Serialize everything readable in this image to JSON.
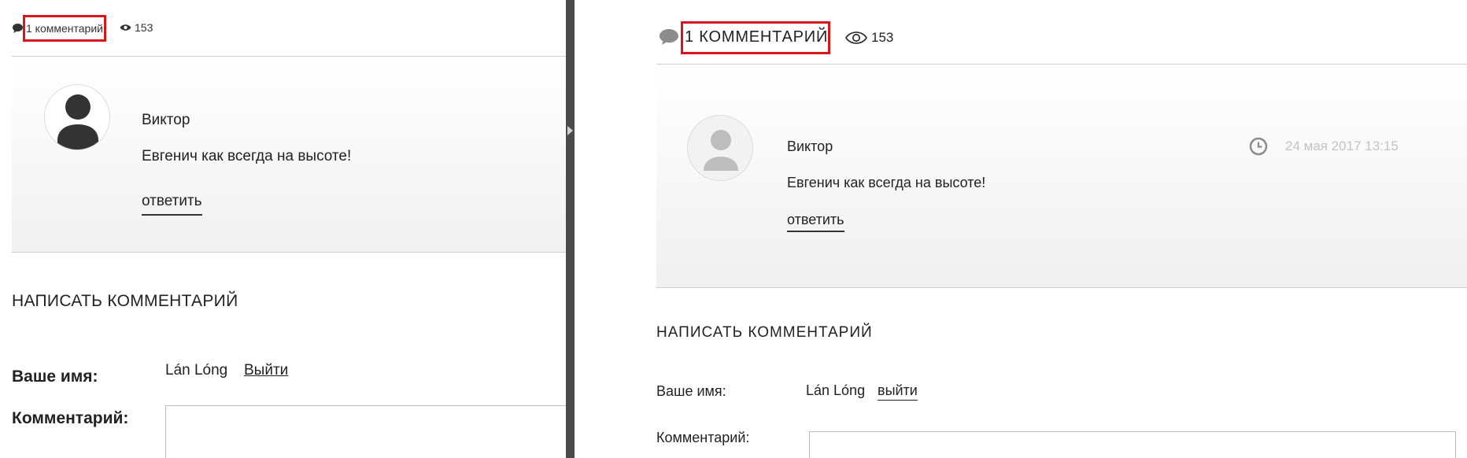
{
  "left": {
    "comments_count": "1 комментарий",
    "views_count": "153",
    "comment": {
      "author": "Виктор",
      "text": "Евгенич как всегда на высоте!",
      "reply_label": "ответить"
    },
    "form": {
      "heading": "НАПИСАТЬ КОММЕНТАРИЙ",
      "name_label": "Ваше имя:",
      "name_value": "Lán Lóng",
      "logout_label": "Выйти",
      "comment_label": "Комментарий:"
    }
  },
  "right": {
    "comments_count": "1 КОММЕНТАРИЙ",
    "views_count": "153",
    "comment": {
      "author": "Виктор",
      "date": "24 мая 2017  13:15",
      "text": "Евгенич как всегда на высоте!",
      "reply_label": "ответить"
    },
    "form": {
      "heading": "НАПИСАТЬ КОММЕНТАРИЙ",
      "name_label": "Ваше имя:",
      "name_value": "Lán Lóng",
      "logout_label": "выйти",
      "comment_label": "Комментарий:"
    }
  },
  "colors": {
    "highlight": "#d9141b",
    "avatar_dark": "#333333",
    "avatar_light": "#bdbdbd",
    "date_text": "#c4c4c4"
  },
  "icons": [
    "comment-bubble-icon",
    "eye-icon",
    "avatar-icon",
    "clock-icon",
    "splitter-arrow-icon"
  ]
}
